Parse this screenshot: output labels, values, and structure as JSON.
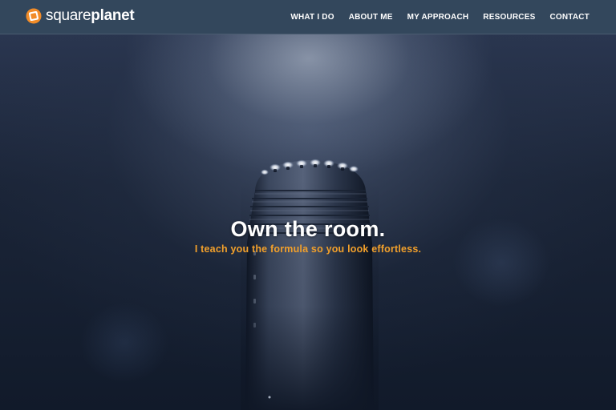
{
  "brand": {
    "name_light": "square",
    "name_bold": "planet",
    "logo_icon": "square-planet-logo-icon",
    "logo_color": "#f28c28"
  },
  "nav": {
    "items": [
      {
        "label": "WHAT I DO"
      },
      {
        "label": "ABOUT ME"
      },
      {
        "label": "MY APPROACH"
      },
      {
        "label": "RESOURCES"
      },
      {
        "label": "CONTACT"
      }
    ]
  },
  "hero": {
    "title": "Own the room.",
    "subtitle": "I teach you the formula so you look effortless.",
    "subtitle_color": "#f2a02b",
    "background_image": "microphone-spotlight-image"
  },
  "colors": {
    "header_bg": "#33475c",
    "accent": "#f2a02b"
  }
}
